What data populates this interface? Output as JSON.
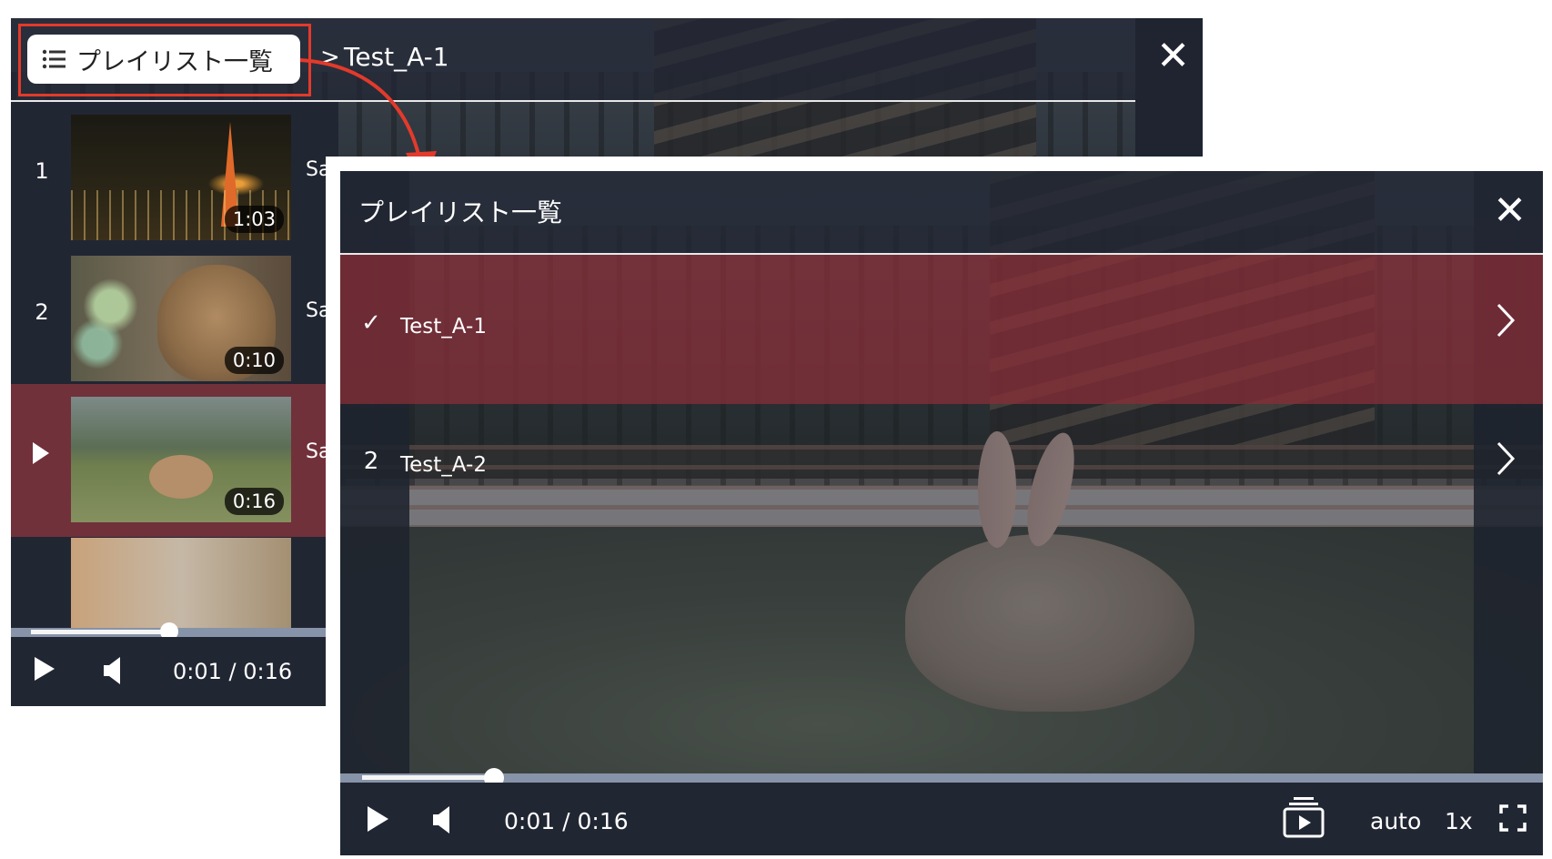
{
  "back_player": {
    "breadcrumb": {
      "playlist_button_label": "プレイリスト一覧",
      "separator": ">",
      "current_title": "Test_A-1"
    },
    "close_glyph": "✕",
    "items": [
      {
        "index": "1",
        "duration": "1:03",
        "label_fragment": "Sa"
      },
      {
        "index": "2",
        "duration": "0:10",
        "label_fragment": "Sa"
      },
      {
        "index": "",
        "duration": "0:16",
        "label_fragment": "Sa"
      },
      {
        "index": "",
        "duration": "",
        "label_fragment": ""
      }
    ],
    "controls": {
      "current_time": "0:01",
      "time_separator": "/",
      "duration": "0:16",
      "progress_fraction": 0.06
    }
  },
  "front_panel": {
    "title": "プレイリスト一覧",
    "close_glyph": "✕",
    "playlists": [
      {
        "mark": "✓",
        "name": "Test_A-1",
        "current": true
      },
      {
        "mark": "2",
        "name": "Test_A-2",
        "current": false
      }
    ],
    "controls": {
      "current_time": "0:01",
      "time_separator": "/",
      "duration": "0:16",
      "quality": "auto",
      "speed": "1x",
      "progress_fraction": 0.06
    }
  },
  "colors": {
    "highlight_red": "#e33a2b",
    "current_row": "#8c2e38",
    "control_bar": "#212633"
  }
}
